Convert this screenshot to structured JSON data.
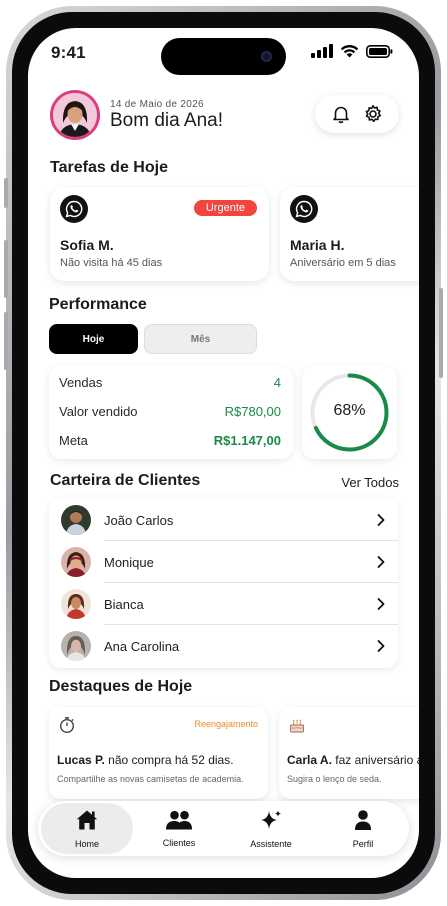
{
  "status_bar": {
    "time": "9:41"
  },
  "header": {
    "date": "14 de Maio de 2026",
    "greeting": "Bom dia Ana!"
  },
  "tasks": {
    "title": "Tarefas de Hoje",
    "items": [
      {
        "name": "Sofia M.",
        "detail": "Não visita há 45 dias",
        "badge": "Urgente"
      },
      {
        "name": "Maria H.",
        "detail": "Aniversário em 5 dias",
        "badge": ""
      }
    ]
  },
  "performance": {
    "title": "Performance",
    "tabs": [
      "Hoje",
      "Mês"
    ],
    "active_tab": "Hoje",
    "rows": [
      {
        "label": "Vendas",
        "value": "4"
      },
      {
        "label": "Valor vendido",
        "value": "R$780,00"
      },
      {
        "label": "Meta",
        "value": "R$1.147,00"
      }
    ],
    "progress_label": "68%",
    "progress_fraction": 0.68
  },
  "clients": {
    "title": "Carteira de Clientes",
    "see_all": "Ver Todos",
    "items": [
      {
        "name": "João Carlos"
      },
      {
        "name": "Monique"
      },
      {
        "name": "Bianca"
      },
      {
        "name": "Ana Carolina"
      }
    ]
  },
  "highlights": {
    "title": "Destaques de Hoje",
    "items": [
      {
        "tag": "Reengajamento",
        "name": "Lucas P.",
        "text": " não compra há 52 dias.",
        "sub": "Compartilhe as novas camisetas de academia."
      },
      {
        "tag": "",
        "name": "Carla A.",
        "text": " faz aniversário a",
        "sub": "Sugira o lenço de seda."
      }
    ]
  },
  "nav": {
    "items": [
      {
        "label": "Home",
        "icon": "home-icon"
      },
      {
        "label": "Clientes",
        "icon": "users-icon"
      },
      {
        "label": "Assistente",
        "icon": "sparkle-icon"
      },
      {
        "label": "Perfil",
        "icon": "person-icon"
      }
    ],
    "active": "Home"
  },
  "colors": {
    "accent_black": "#000000",
    "urgent_red": "#f2453d",
    "money_green": "#1a8a4a",
    "tag_orange": "#f08a24",
    "avatar_ring": "#e0397f"
  }
}
